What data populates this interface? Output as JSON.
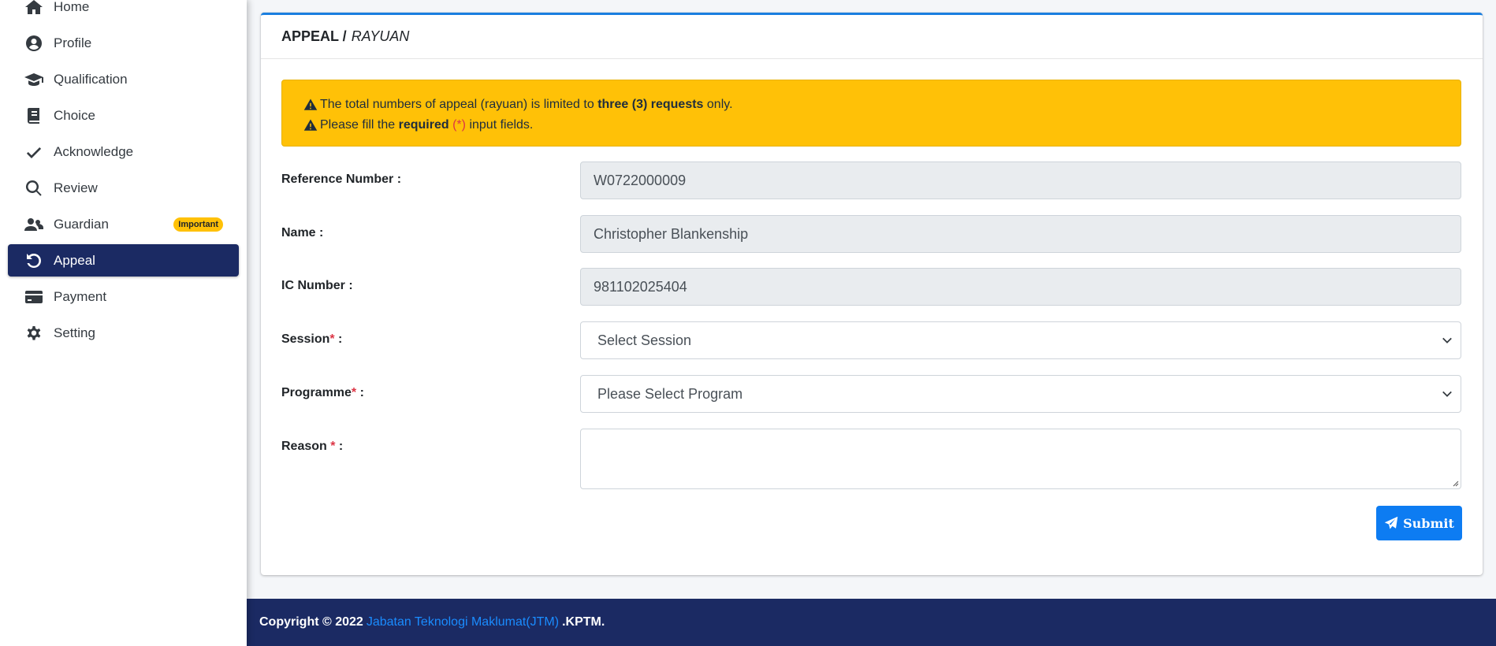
{
  "sidebar": {
    "items": [
      {
        "label": "Home",
        "icon": "home-icon"
      },
      {
        "label": "Profile",
        "icon": "user-circle-icon"
      },
      {
        "label": "Qualification",
        "icon": "graduation-cap-icon"
      },
      {
        "label": "Choice",
        "icon": "book-icon"
      },
      {
        "label": "Acknowledge",
        "icon": "check-icon"
      },
      {
        "label": "Review",
        "icon": "search-icon"
      },
      {
        "label": "Guardian",
        "icon": "users-icon",
        "badge": "Important"
      },
      {
        "label": "Appeal",
        "icon": "undo-icon",
        "active": true
      },
      {
        "label": "Payment",
        "icon": "credit-card-icon"
      },
      {
        "label": "Setting",
        "icon": "gear-icon"
      }
    ]
  },
  "card": {
    "title": "APPEAL /",
    "title_italic": "RAYUAN"
  },
  "alert": {
    "line1_pre": "The total numbers of appeal (rayuan) is limited to",
    "line1_bold": "three (3) requests",
    "line1_post": "only.",
    "line2_pre": "Please fill the",
    "line2_bold": "required",
    "line2_req": "(*)",
    "line2_post": "input fields."
  },
  "form": {
    "reference_label": "Reference Number :",
    "reference_value": "W0722000009",
    "name_label": "Name :",
    "name_value": "Christopher Blankenship",
    "ic_label": "IC Number :",
    "ic_value": "981102025404",
    "session_label": "Session",
    "session_req": "*",
    "session_colon": " :",
    "session_selected": "Select Session",
    "programme_label": "Programme",
    "programme_req": "*",
    "programme_colon": " :",
    "programme_selected": "Please Select Program",
    "reason_label": "Reason",
    "reason_req": "*",
    "reason_colon": " :",
    "reason_value": ""
  },
  "submit_label": "Submit",
  "footer": {
    "prefix": "Copyright © 2022",
    "link": "Jabatan Teknologi Maklumat(JTM)",
    "suffix": ".KPTM."
  },
  "colors": {
    "sidebar_active": "#1b2a63",
    "alert_bg": "#ffc107",
    "primary": "#0d7cf2",
    "card_top_border": "#1a7fe0",
    "footer_bg": "#1b2a63",
    "required": "#dc3545"
  }
}
